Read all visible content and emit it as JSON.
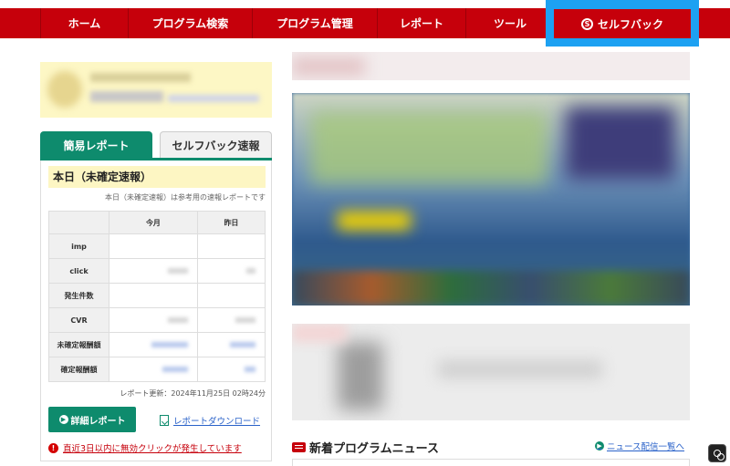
{
  "nav": {
    "items": [
      "ホーム",
      "プログラム検索",
      "プログラム管理",
      "レポート",
      "ツール"
    ],
    "selfback": "セルフバック",
    "selfback_icon": "S",
    "highlight_color": "#1da1f2",
    "bar_color": "#c6000b"
  },
  "tabs": {
    "active": "簡易レポート",
    "inactive": "セルフバック速報"
  },
  "report": {
    "title": "本日（未確定速報）",
    "note": "本日（未確定速報）は参考用の速報レポートです",
    "columns": [
      "",
      "今月",
      "昨日"
    ],
    "rows": [
      "imp",
      "click",
      "発生件数",
      "CVR",
      "未確定報酬額",
      "確定報酬額"
    ],
    "updated": "レポート更新：2024年11月25日 02時24分",
    "detail_button": "詳細レポート",
    "download_link": "レポートダウンロード",
    "warning": "直近3日以内に無効クリックが発生しています"
  },
  "news": {
    "title": "新着プログラムニュース",
    "link": "ニュース配信一覧へ"
  },
  "accent_color": "#0e8b6d"
}
